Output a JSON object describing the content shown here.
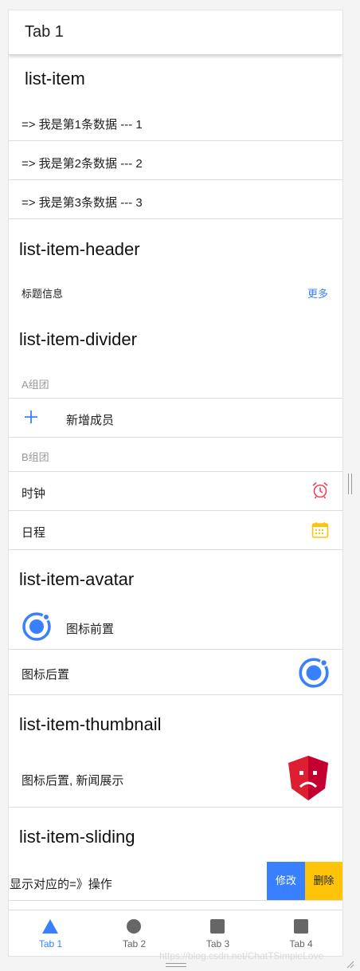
{
  "toolbar": {
    "title": "Tab 1"
  },
  "sections": {
    "list_item": {
      "title": "list-item",
      "rows": [
        "=> 我是第1条数据 --- 1",
        "=> 我是第2条数据 --- 2",
        "=> 我是第3条数据 --- 3"
      ]
    },
    "list_item_header": {
      "title": "list-item-header",
      "header_label": "标题信息",
      "more_link": "更多"
    },
    "list_item_divider": {
      "title": "list-item-divider",
      "group_a": "A组团",
      "add_member": "新增成员",
      "group_b": "B组团",
      "clock": "时钟",
      "schedule": "日程"
    },
    "list_item_avatar": {
      "title": "list-item-avatar",
      "icon_front": "图标前置",
      "icon_back": "图标后置"
    },
    "list_item_thumbnail": {
      "title": "list-item-thumbnail",
      "news": "图标后置, 新闻展示"
    },
    "list_item_sliding": {
      "title": "list-item-sliding",
      "text": "显示对应的=》操作",
      "edit": "修改",
      "delete": "删除"
    }
  },
  "tabs": [
    {
      "label": "Tab 1",
      "icon": "triangle-icon",
      "active": true
    },
    {
      "label": "Tab 2",
      "icon": "circle-icon",
      "active": false
    },
    {
      "label": "Tab 3",
      "icon": "square-icon",
      "active": false
    },
    {
      "label": "Tab 4",
      "icon": "square-icon",
      "active": false
    }
  ],
  "watermark": "https://blog.csdn.net/ChatTSimpleLove",
  "colors": {
    "primary": "#3880ff",
    "warning": "#ffc409",
    "danger": "#eb445a"
  }
}
